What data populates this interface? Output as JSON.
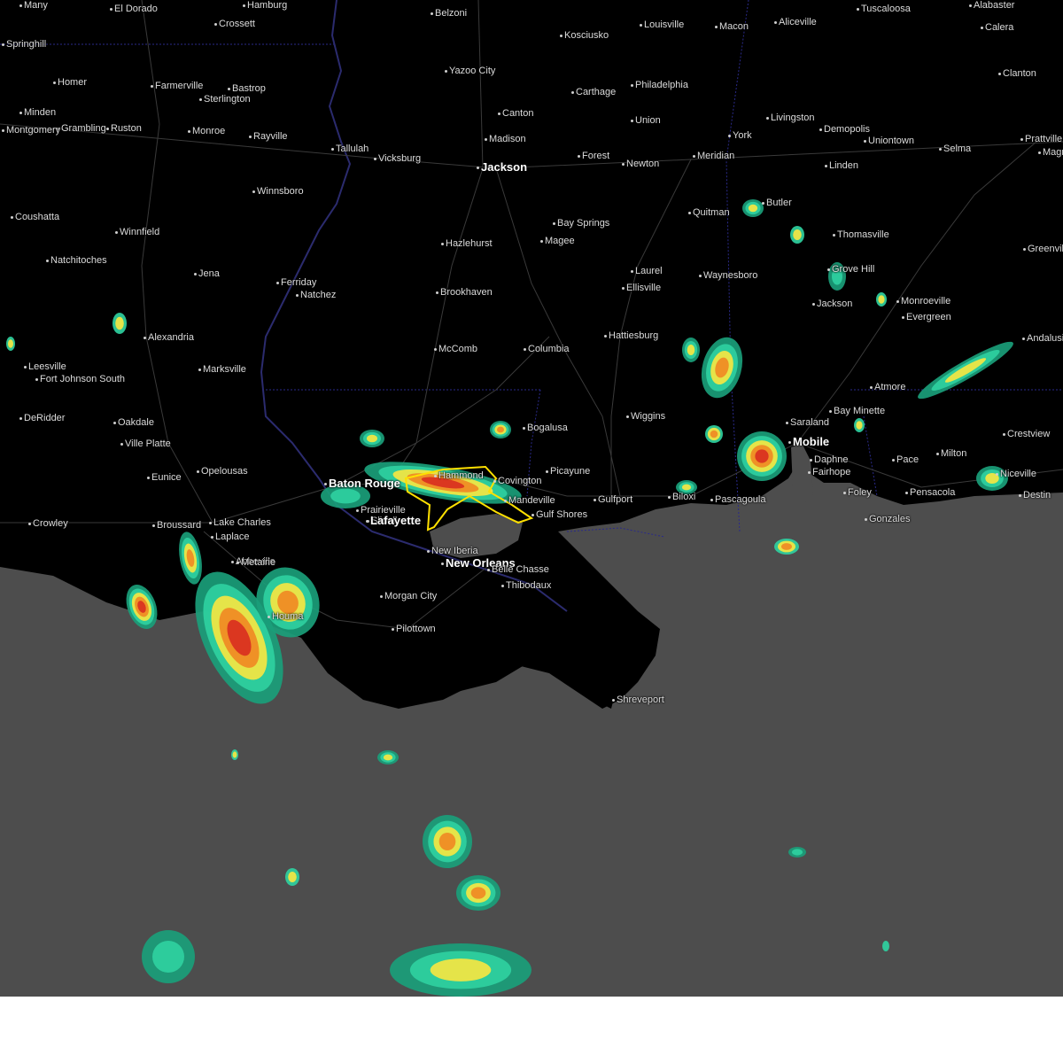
{
  "colors": {
    "land": "#000000",
    "water": "#4d4d4d",
    "warning_polygon": "#ffe000",
    "radar_light": "#1a9e7a",
    "radar_mid": "#2fd0a0",
    "radar_yellow": "#f5e642",
    "radar_orange": "#f08a24",
    "radar_red": "#d93020",
    "state_border": "#2a2a8a",
    "river": "#2b2b6e"
  },
  "cities": [
    {
      "name": "El Dorado",
      "major": false
    },
    {
      "name": "Hamburg",
      "major": false
    },
    {
      "name": "Belzoni",
      "major": false
    },
    {
      "name": "Louisville",
      "major": false
    },
    {
      "name": "Macon",
      "major": false
    },
    {
      "name": "Aliceville",
      "major": false
    },
    {
      "name": "Tuscaloosa",
      "major": false
    },
    {
      "name": "Alabaster",
      "major": false
    },
    {
      "name": "Crossett",
      "major": false
    },
    {
      "name": "Kosciusko",
      "major": false
    },
    {
      "name": "Calera",
      "major": false
    },
    {
      "name": "Springhill",
      "major": false
    },
    {
      "name": "Yazoo City",
      "major": false
    },
    {
      "name": "Clanton",
      "major": false
    },
    {
      "name": "Homer",
      "major": false
    },
    {
      "name": "Farmerville",
      "major": false
    },
    {
      "name": "Bastrop",
      "major": false
    },
    {
      "name": "Carthage",
      "major": false
    },
    {
      "name": "Philadelphia",
      "major": false
    },
    {
      "name": "Sterlington",
      "major": false
    },
    {
      "name": "Minden",
      "major": false
    },
    {
      "name": "Canton",
      "major": false
    },
    {
      "name": "Livingston",
      "major": false
    },
    {
      "name": "Union",
      "major": false
    },
    {
      "name": "Grambling",
      "major": false
    },
    {
      "name": "Ruston",
      "major": false
    },
    {
      "name": "Monroe",
      "major": false
    },
    {
      "name": "Demopolis",
      "major": false
    },
    {
      "name": "Rayville",
      "major": false
    },
    {
      "name": "Madison",
      "major": false
    },
    {
      "name": "York",
      "major": false
    },
    {
      "name": "Uniontown",
      "major": false
    },
    {
      "name": "Prattville",
      "major": false
    },
    {
      "name": "Tallulah",
      "major": false
    },
    {
      "name": "Selma",
      "major": false
    },
    {
      "name": "Vicksburg",
      "major": false
    },
    {
      "name": "Forest",
      "major": false
    },
    {
      "name": "Meridian",
      "major": false
    },
    {
      "name": "Jackson",
      "major": true
    },
    {
      "name": "Newton",
      "major": false
    },
    {
      "name": "Linden",
      "major": false
    },
    {
      "name": "Winnsboro",
      "major": false
    },
    {
      "name": "Butler",
      "major": false
    },
    {
      "name": "Quitman",
      "major": false
    },
    {
      "name": "Coushatta",
      "major": false
    },
    {
      "name": "Bay Springs",
      "major": false
    },
    {
      "name": "Thomasville",
      "major": false
    },
    {
      "name": "Winnfield",
      "major": false
    },
    {
      "name": "Hazlehurst",
      "major": false
    },
    {
      "name": "Magee",
      "major": false
    },
    {
      "name": "Greenville",
      "major": false
    },
    {
      "name": "Natchitoches",
      "major": false
    },
    {
      "name": "Grove Hill",
      "major": false
    },
    {
      "name": "Jena",
      "major": false
    },
    {
      "name": "Laurel",
      "major": false
    },
    {
      "name": "Waynesboro",
      "major": false
    },
    {
      "name": "Ferriday",
      "major": false
    },
    {
      "name": "Ellisville",
      "major": false
    },
    {
      "name": "Brookhaven",
      "major": false
    },
    {
      "name": "Natchez",
      "major": false
    },
    {
      "name": "Monroeville",
      "major": false
    },
    {
      "name": "Jackson",
      "major": false
    },
    {
      "name": "Evergreen",
      "major": false
    },
    {
      "name": "Hattiesburg",
      "major": false
    },
    {
      "name": "Alexandria",
      "major": false
    },
    {
      "name": "Andalusia",
      "major": false
    },
    {
      "name": "Columbia",
      "major": false
    },
    {
      "name": "McComb",
      "major": false
    },
    {
      "name": "Leesville",
      "major": false
    },
    {
      "name": "Marksville",
      "major": false
    },
    {
      "name": "Fort Johnson South",
      "major": false
    },
    {
      "name": "Atmore",
      "major": false
    },
    {
      "name": "DeRidder",
      "major": false
    },
    {
      "name": "Wiggins",
      "major": false
    },
    {
      "name": "Bay Minette",
      "major": false
    },
    {
      "name": "Oakdale",
      "major": false
    },
    {
      "name": "Saraland",
      "major": false
    },
    {
      "name": "Bogalusa",
      "major": false
    },
    {
      "name": "Crestview",
      "major": false
    },
    {
      "name": "Ville Platte",
      "major": false
    },
    {
      "name": "Mobile",
      "major": true
    },
    {
      "name": "Milton",
      "major": false
    },
    {
      "name": "Daphne",
      "major": false
    },
    {
      "name": "Pace",
      "major": false
    },
    {
      "name": "Fairhope",
      "major": false
    },
    {
      "name": "Niceville",
      "major": false
    },
    {
      "name": "Opelousas",
      "major": false
    },
    {
      "name": "Hammond",
      "major": false
    },
    {
      "name": "Covington",
      "major": false
    },
    {
      "name": "Picayune",
      "major": false
    },
    {
      "name": "Eunice",
      "major": false
    },
    {
      "name": "Baton Rouge",
      "major": true
    },
    {
      "name": "Gulfport",
      "major": false
    },
    {
      "name": "Biloxi",
      "major": false
    },
    {
      "name": "Pascagoula",
      "major": false
    },
    {
      "name": "Foley",
      "major": false
    },
    {
      "name": "Pensacola",
      "major": false
    },
    {
      "name": "Destin",
      "major": false
    },
    {
      "name": "Mandeville",
      "major": false
    },
    {
      "name": "Prairieville",
      "major": false
    },
    {
      "name": "Slidell",
      "major": false
    },
    {
      "name": "Gulf Shores",
      "major": false
    },
    {
      "name": "Gonzales",
      "major": false
    },
    {
      "name": "Lafayette",
      "major": true
    },
    {
      "name": "Lake Charles",
      "major": false
    },
    {
      "name": "Crowley",
      "major": false
    },
    {
      "name": "Broussard",
      "major": false
    },
    {
      "name": "Laplace",
      "major": false
    },
    {
      "name": "New Iberia",
      "major": false
    },
    {
      "name": "Abbeville",
      "major": false
    },
    {
      "name": "Metairie",
      "major": false
    },
    {
      "name": "New Orleans",
      "major": true
    },
    {
      "name": "Belle Chasse",
      "major": false
    },
    {
      "name": "Thibodaux",
      "major": false
    },
    {
      "name": "Morgan City",
      "major": false
    },
    {
      "name": "Houma",
      "major": false
    },
    {
      "name": "Pilottown",
      "major": false
    },
    {
      "name": "Shreveport",
      "major": false
    },
    {
      "name": "Montgomery",
      "major": false
    },
    {
      "name": "Magnolia",
      "major": false
    },
    {
      "name": "Many",
      "major": false
    }
  ]
}
